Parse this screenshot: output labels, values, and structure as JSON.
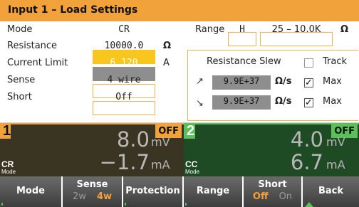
{
  "title": "Input 1 – Load Settings",
  "settings": {
    "mode_label": "Mode",
    "mode_value": "CR",
    "resistance_label": "Resistance",
    "resistance_value": "10000.0",
    "resistance_unit": "Ω",
    "current_limit_label": "Current Limit",
    "current_limit_value": "6.120",
    "current_limit_unit": "A",
    "sense_label": "Sense",
    "sense_value": "4 wire",
    "short_label": "Short",
    "short_value": "Off"
  },
  "range": {
    "label": "Range",
    "value": "H",
    "span": "25 – 10.0K",
    "unit": "Ω"
  },
  "slew": {
    "title": "Resistance Slew",
    "track_label": "Track",
    "track_checked": false,
    "rise_value": "9.9E+37",
    "rise_unit": "Ω/s",
    "rise_max_label": "Max",
    "rise_max_checked": true,
    "fall_value": "9.9E+37",
    "fall_unit": "Ω/s",
    "fall_max_label": "Max",
    "fall_max_checked": true,
    "rise_icon": "rise-arrow-icon",
    "fall_icon": "fall-arrow-icon"
  },
  "channels": [
    {
      "number": "1",
      "state": "OFF",
      "voltage": "8.0",
      "voltage_unit": "mV",
      "current": "−1.7",
      "current_unit": "mA",
      "mode": "CR",
      "mode_label": "Mode",
      "color": "#f2a23a"
    },
    {
      "number": "2",
      "state": "OFF",
      "voltage": "4.0",
      "voltage_unit": "mV",
      "current": "6.7",
      "current_unit": "mA",
      "mode": "CC",
      "mode_label": "Mode",
      "color": "#5bc05a"
    }
  ],
  "softkeys": {
    "mode": "Mode",
    "sense_top": "Sense",
    "sense_2w": "2w",
    "sense_4w": "4w",
    "protection": "Protection",
    "range": "Range",
    "short_top": "Short",
    "short_off": "Off",
    "short_on": "On",
    "back": "Back"
  },
  "colors": {
    "accent": "#f2a23a",
    "highlight": "#f8c61c",
    "channel2": "#5bc05a"
  }
}
